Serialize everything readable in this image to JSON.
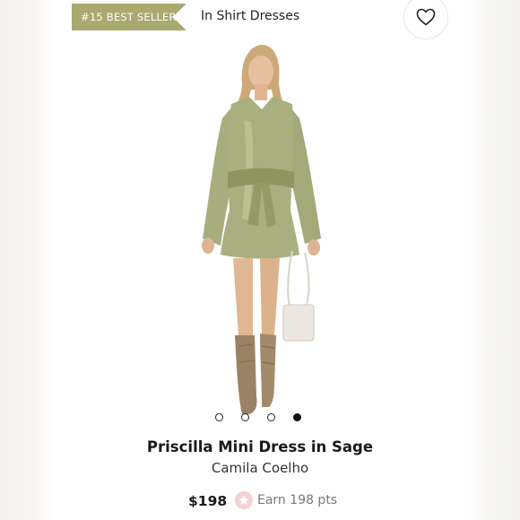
{
  "header": {
    "badge_label": "#15 BEST SELLER",
    "category_label": "In Shirt Dresses"
  },
  "carousel": {
    "total_slides": 4,
    "active_slide": 4
  },
  "product": {
    "name": "Priscilla Mini Dress in Sage",
    "brand": "Camila Coelho",
    "price": "$198",
    "points_label": "Earn 198 pts"
  },
  "colors": {
    "badge": "#a9a970",
    "dress": "#a7ad7c",
    "points_icon": "#f2d3d3"
  },
  "icons": {
    "wishlist": "heart-icon",
    "points": "star-icon"
  }
}
